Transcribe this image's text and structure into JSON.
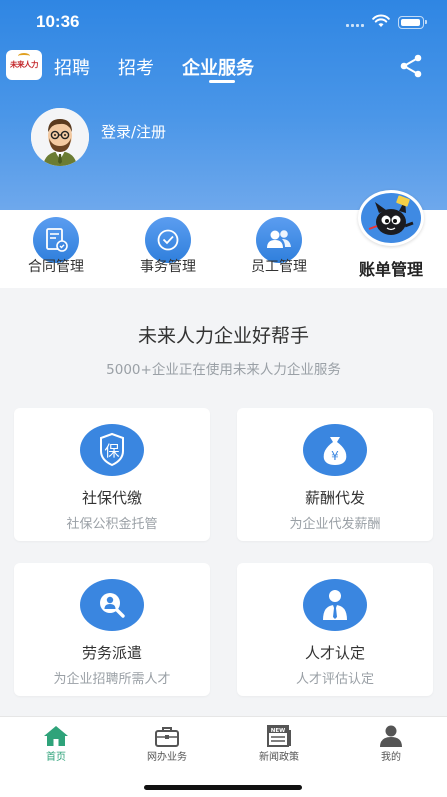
{
  "status": {
    "time": "10:36"
  },
  "app": {
    "logo_text": "未来人力",
    "tabs": [
      {
        "label": "招聘"
      },
      {
        "label": "招考"
      },
      {
        "label": "企业服务",
        "active": true
      }
    ],
    "share_icon": "share-icon"
  },
  "profile": {
    "login_label": "登录/注册"
  },
  "quick_actions": [
    {
      "label": "合同管理",
      "icon": "contract-icon"
    },
    {
      "label": "事务管理",
      "icon": "affairs-icon"
    },
    {
      "label": "员工管理",
      "icon": "employees-icon"
    },
    {
      "label": "账单管理",
      "icon": "bill-mascot-icon"
    }
  ],
  "section": {
    "title": "未来人力企业好帮手",
    "subtitle": "5000+企业正在使用未来人力企业服务"
  },
  "services": [
    {
      "title": "社保代缴",
      "subtitle": "社保公积金托管",
      "icon": "social-insurance-icon",
      "icon_text": "保"
    },
    {
      "title": "薪酬代发",
      "subtitle": "为企业代发薪酬",
      "icon": "money-bag-icon",
      "icon_text": "¥"
    },
    {
      "title": "劳务派遣",
      "subtitle": "为企业招聘所需人才",
      "icon": "search-person-icon"
    },
    {
      "title": "人才认定",
      "subtitle": "人才评估认定",
      "icon": "talent-person-icon"
    }
  ],
  "bottom_nav": [
    {
      "label": "首页",
      "icon": "home-icon",
      "active": true
    },
    {
      "label": "网办业务",
      "icon": "briefcase-icon"
    },
    {
      "label": "新闻政策",
      "icon": "newspaper-icon",
      "badge": "NEW"
    },
    {
      "label": "我的",
      "icon": "user-icon"
    }
  ],
  "colors": {
    "primary": "#2f86e3",
    "accent_green": "#2fa37a",
    "icon_blue": "#3a86e0"
  }
}
